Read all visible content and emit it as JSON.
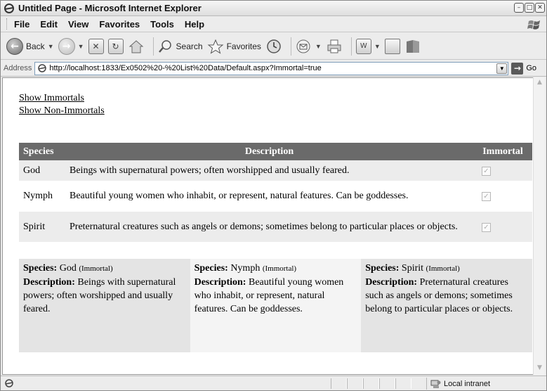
{
  "window": {
    "title": "Untitled Page - Microsoft Internet Explorer"
  },
  "menu": [
    "File",
    "Edit",
    "View",
    "Favorites",
    "Tools",
    "Help"
  ],
  "toolbar": {
    "back_label": "Back",
    "search_label": "Search",
    "favorites_label": "Favorites"
  },
  "address": {
    "label": "Address",
    "url": "http://localhost:1833/Ex0502%20-%20List%20Data/Default.aspx?Immortal=true",
    "go_label": "Go"
  },
  "page": {
    "links": {
      "show_immortals": "Show Immortals",
      "show_non_immortals": "Show Non-Immortals"
    },
    "grid": {
      "columns": [
        "Species",
        "Description",
        "Immortal"
      ],
      "rows": [
        {
          "species": "God",
          "description": "Beings with supernatural powers; often worshipped and usually feared.",
          "immortal": true
        },
        {
          "species": "Nymph",
          "description": "Beautiful young women who inhabit, or represent, natural features. Can be goddesses.",
          "immortal": true
        },
        {
          "species": "Spirit",
          "description": "Preternatural creatures such as angels or demons; sometimes belong to particular places or objects.",
          "immortal": true
        }
      ]
    },
    "repeater": {
      "species_label": "Species:",
      "description_label": "Description:",
      "immortal_tag": "(Immortal)",
      "items": [
        {
          "species": "God",
          "description": "Beings with supernatural powers; often worshipped and usually feared."
        },
        {
          "species": "Nymph",
          "description": "Beautiful young women who inhabit, or represent, natural features. Can be goddesses."
        },
        {
          "species": "Spirit",
          "description": "Preternatural creatures such as angels or demons; sometimes belong to particular places or objects."
        }
      ]
    }
  },
  "status": {
    "zone": "Local intranet"
  }
}
